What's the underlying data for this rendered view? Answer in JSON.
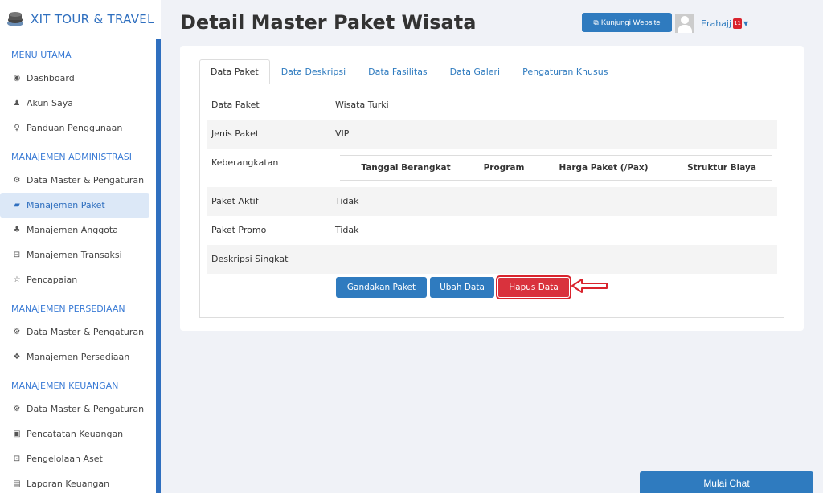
{
  "brand": {
    "name": "XIT TOUR & TRAVEL",
    "icon": "stack-logo-icon"
  },
  "sidebar": {
    "sections": [
      {
        "title": "MENU UTAMA",
        "items": [
          {
            "label": "Dashboard",
            "icon": "globe-icon"
          },
          {
            "label": "Akun Saya",
            "icon": "user-icon"
          },
          {
            "label": "Panduan Penggunaan",
            "icon": "lightbulb-icon"
          }
        ]
      },
      {
        "title": "MANAJEMEN ADMINISTRASI",
        "items": [
          {
            "label": "Data Master & Pengaturan",
            "icon": "gears-icon"
          },
          {
            "label": "Manajemen Paket",
            "icon": "book-icon",
            "active": true
          },
          {
            "label": "Manajemen Anggota",
            "icon": "users-icon"
          },
          {
            "label": "Manajemen Transaksi",
            "icon": "cart-icon"
          },
          {
            "label": "Pencapaian",
            "icon": "star-icon"
          }
        ]
      },
      {
        "title": "MANAJEMEN PERSEDIAAN",
        "items": [
          {
            "label": "Data Master & Pengaturan",
            "icon": "gears-icon"
          },
          {
            "label": "Manajemen Persediaan",
            "icon": "cubes-icon"
          }
        ]
      },
      {
        "title": "MANAJEMEN KEUANGAN",
        "items": [
          {
            "label": "Data Master & Pengaturan",
            "icon": "gears-icon"
          },
          {
            "label": "Pencatatan Keuangan",
            "icon": "money-icon"
          },
          {
            "label": "Pengelolaan Aset",
            "icon": "inbox-icon"
          },
          {
            "label": "Laporan Keuangan",
            "icon": "chart-icon"
          }
        ]
      }
    ]
  },
  "header": {
    "title": "Detail Master Paket Wisata",
    "visit_label": "Kunjungi Website",
    "username": "Erahajj",
    "badge_count": "11"
  },
  "tabs": [
    "Data Paket",
    "Data Deskripsi",
    "Data Fasilitas",
    "Data Galeri",
    "Pengaturan Khusus"
  ],
  "details": {
    "rows": [
      {
        "label": "Data Paket",
        "value": "Wisata Turki"
      },
      {
        "label": "Jenis Paket",
        "value": "VIP"
      },
      {
        "label": "Keberangkatan",
        "value": ""
      },
      {
        "label": "Paket Aktif",
        "value": "Tidak"
      },
      {
        "label": "Paket Promo",
        "value": "Tidak"
      },
      {
        "label": "Deskripsi Singkat",
        "value": ""
      }
    ],
    "departure_headers": [
      "Tanggal Berangkat",
      "Program",
      "Harga Paket (/Pax)",
      "Struktur Biaya"
    ]
  },
  "actions": {
    "duplicate_label": "Gandakan Paket",
    "edit_label": "Ubah Data",
    "delete_label": "Hapus Data"
  },
  "chat": {
    "label": "Mulai Chat"
  },
  "colors": {
    "primary": "#2f7bbf",
    "danger": "#d9323d",
    "sidebar_active_bg": "#dce8f7"
  }
}
